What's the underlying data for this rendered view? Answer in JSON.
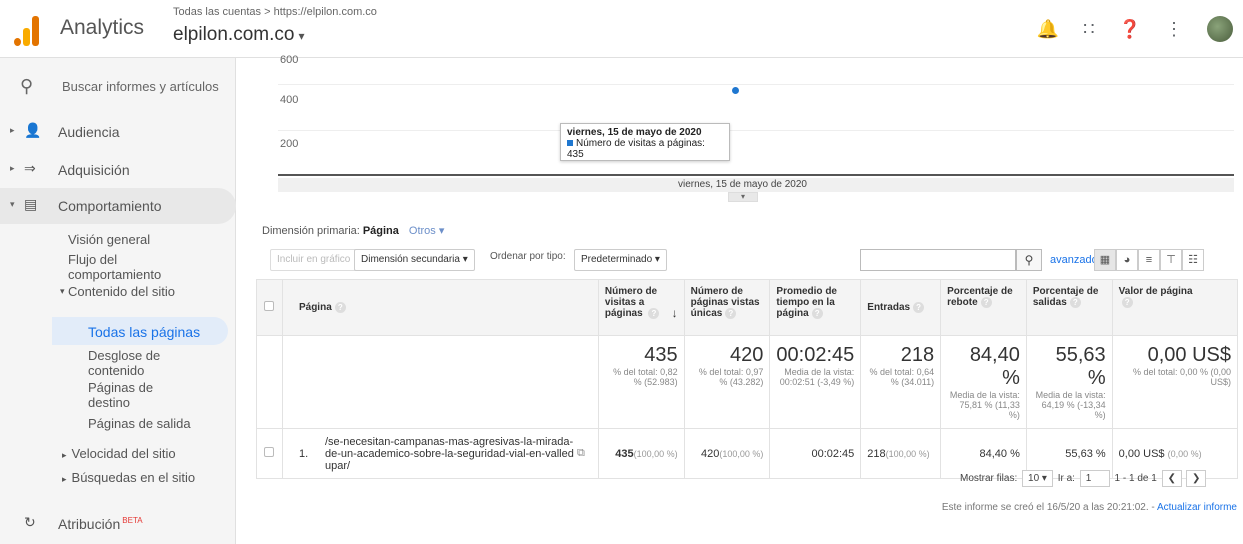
{
  "header": {
    "app_name": "Analytics",
    "breadcrumb": "Todas las cuentas > https://elpilon.com.co",
    "property": "elpilon.com.co",
    "caret": "▾",
    "icons": [
      "bell-icon",
      "apps-icon",
      "help-icon",
      "more-icon",
      "avatar"
    ]
  },
  "sidebar": {
    "search_placeholder": "Buscar informes y artículos",
    "items": [
      {
        "label": "Audiencia",
        "icon": "person-icon"
      },
      {
        "label": "Adquisición",
        "icon": "acquisition-icon"
      },
      {
        "label": "Comportamiento",
        "icon": "behavior-icon"
      }
    ],
    "sub_items": [
      "Visión general",
      "Flujo del comportamiento",
      "Contenido del sitio"
    ],
    "content_items": [
      "Todas las páginas",
      "Desglose de contenido",
      "Páginas de destino",
      "Páginas de salida"
    ],
    "more_items": [
      "Velocidad del sitio",
      "Búsquedas en el sitio"
    ],
    "attribution": "Atribución",
    "beta": "BETA"
  },
  "chart": {
    "ytick_top": "600",
    "ytick_mid": "400",
    "ytick_low": "200",
    "tooltip_title": "viernes, 15 de mayo de 2020",
    "tooltip_metric": "Número de visitas a páginas: 435",
    "date_label": "viernes, 15 de mayo de 2020",
    "point_value": 435,
    "y_min": 0,
    "y_max": 600
  },
  "dimension": {
    "label": "Dimensión primaria:",
    "value": "Página",
    "other": "Otros"
  },
  "toolbar": {
    "include_chart": "Incluir en gráfico",
    "secondary": "Dimensión secundaria",
    "sort_label": "Ordenar por tipo:",
    "sort_value": "Predeterminado",
    "advanced": "avanzado",
    "search_value": ""
  },
  "table": {
    "headers": {
      "page": "Página",
      "views": "Número de visitas a páginas",
      "unique": "Número de páginas vistas únicas",
      "avg_time": "Promedio de tiempo en la página",
      "entries": "Entradas",
      "bounce": "Porcentaje de rebote",
      "exits": "Porcentaje de salidas",
      "value": "Valor de página"
    },
    "totals": {
      "views": "435",
      "views_sub": "% del total: 0,82 % (52.983)",
      "unique": "420",
      "unique_sub": "% del total: 0,97 % (43.282)",
      "avg_time": "00:02:45",
      "avg_time_sub": "Media de la vista: 00:02:51 (-3,49 %)",
      "entries": "218",
      "entries_sub": "% del total: 0,64 % (34.011)",
      "bounce": "84,40 %",
      "bounce_sub": "Media de la vista: 75,81 % (11,33 %)",
      "exits": "55,63 %",
      "exits_sub": "Media de la vista: 64,19 % (-13,34 %)",
      "value": "0,00 US$",
      "value_sub": "% del total: 0,00 % (0,00 US$)"
    },
    "rows": [
      {
        "index": "1.",
        "page": "/se-necesitan-campanas-mas-agresivas-la-mirada-de-un-academico-sobre-la-seguridad-vial-en-valledupar/",
        "views": "435",
        "views_pct": "(100,00 %)",
        "unique": "420",
        "unique_pct": "(100,00 %)",
        "avg_time": "00:02:45",
        "entries": "218",
        "entries_pct": "(100,00 %)",
        "bounce": "84,40 %",
        "exits": "55,63 %",
        "value": "0,00 US$",
        "value_pct": "(0,00 %)"
      }
    ]
  },
  "pager": {
    "show_rows": "Mostrar filas:",
    "rows_value": "10",
    "goto": "Ir a:",
    "goto_value": "1",
    "range": "1 - 1 de 1"
  },
  "footer": {
    "text": "Este informe se creó el 16/5/20 a las 20:21:02. -",
    "link": "Actualizar informe"
  }
}
